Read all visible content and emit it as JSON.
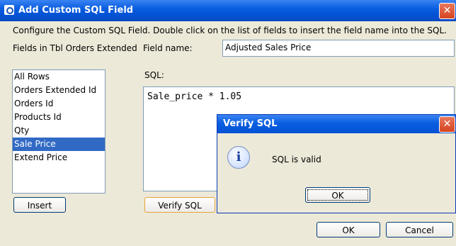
{
  "window": {
    "title": "Add Custom SQL Field",
    "close_glyph": "✕"
  },
  "instructions": "Configure the Custom SQL Field.  Double click on the list of fields to insert the field name into the SQL.",
  "fields_label": "Fields in Tbl Orders Extended",
  "field_name_label": "Field name:",
  "field_name_value": "Adjusted Sales Price",
  "fields_list": {
    "items": [
      "All Rows",
      "Orders Extended Id",
      "Orders Id",
      "Products Id",
      "Qty",
      "Sale Price",
      "Extend Price"
    ],
    "selected": "Sale Price"
  },
  "sql_label": "SQL:",
  "sql_value": "Sale_price * 1.05",
  "buttons": {
    "insert": "Insert",
    "verify": "Verify SQL",
    "ok": "OK",
    "cancel": "Cancel"
  },
  "verify_dialog": {
    "title": "Verify SQL",
    "message": "SQL is valid",
    "ok": "OK",
    "icon": "info-icon",
    "icon_glyph": "i",
    "close_glyph": "✕"
  },
  "colors": {
    "title_bar": "#0a5ee0",
    "selection": "#316ac5",
    "close_button": "#d5441f",
    "window_bg": "#ece9d8"
  }
}
